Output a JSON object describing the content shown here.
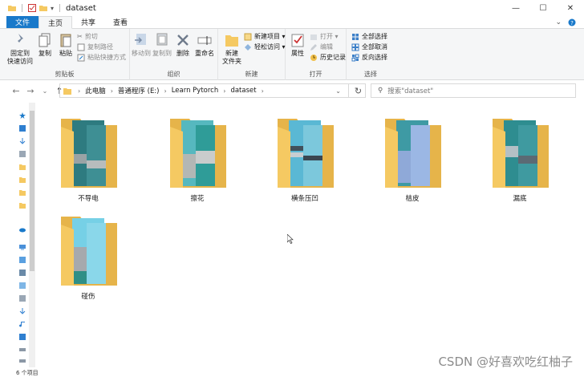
{
  "window": {
    "title": "dataset"
  },
  "window_controls": {
    "minimize": "—",
    "maximize": "☐",
    "close": "✕"
  },
  "tabs": [
    {
      "label": "文件"
    },
    {
      "label": "主页"
    },
    {
      "label": "共享"
    },
    {
      "label": "查看"
    }
  ],
  "ribbon": {
    "clipboard": {
      "label": "剪贴板",
      "pin": "固定到\n快速访问",
      "copy": "复制",
      "paste": "粘贴",
      "cut": "剪切",
      "copy_path": "复制路径",
      "paste_shortcut": "粘贴快捷方式"
    },
    "organize": {
      "label": "组织",
      "move_to": "移动到",
      "copy_to": "复制到",
      "delete": "删除",
      "rename": "重命名"
    },
    "new": {
      "label": "新建",
      "new_folder": "新建\n文件夹",
      "new_item": "新建项目 ▾",
      "easy_access": "轻松访问 ▾"
    },
    "open": {
      "label": "打开",
      "properties": "属性",
      "open": "打开 ▾",
      "edit": "编辑",
      "history": "历史记录"
    },
    "select": {
      "label": "选择",
      "select_all": "全部选择",
      "select_none": "全部取消",
      "invert": "反向选择"
    }
  },
  "address": {
    "crumbs": [
      "此电脑",
      "普通程序 (E:)",
      "Learn Pytorch",
      "dataset"
    ],
    "search_placeholder": "搜索\"dataset\""
  },
  "folders": [
    {
      "name": "不导电"
    },
    {
      "name": "擦花"
    },
    {
      "name": "横条压凹"
    },
    {
      "name": "桔皮"
    },
    {
      "name": "漏底"
    },
    {
      "name": "碰伤"
    }
  ],
  "status": {
    "count": "6 个项目"
  },
  "watermark": "CSDN @好喜欢吃红柚子",
  "colors": {
    "file_tab": "#1979ca",
    "folder": "#f5c962",
    "folder_dark": "#e6b44a"
  }
}
